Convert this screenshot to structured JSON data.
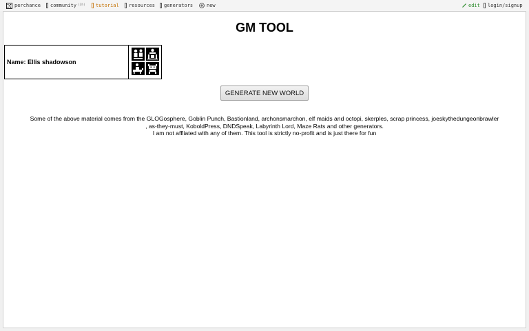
{
  "nav": {
    "items": [
      {
        "label": "perchance",
        "icon": "dice-icon"
      },
      {
        "label": "community",
        "badge": "(3h)",
        "icon": "community-icon"
      },
      {
        "label": "tutorial",
        "icon": "tutorial-icon"
      },
      {
        "label": "resources",
        "icon": "resources-icon"
      },
      {
        "label": "generators",
        "icon": "generators-icon"
      },
      {
        "label": "new",
        "icon": "plus-circle-icon"
      }
    ],
    "edit_label": "edit",
    "login_label": "login/signup"
  },
  "main": {
    "title": "GM TOOL",
    "npc": {
      "name": "Name: Ellis shadowson",
      "portrait_icons": [
        "heroes-icon",
        "camp-icon",
        "rider-icon",
        "monsters-icon"
      ]
    },
    "generate_label": "GENERATE NEW WORLD",
    "credits": {
      "line1": "Some of the above material comes from the GLOGosphere, Goblin Punch, Bastionland, archonsmarchon, elf maids and octopi, skerples, scrap princess, joeskythedungeonbrawler",
      "line2": ", as-they-must, KoboldPress, DNDSpeak, Labyrinth Lord, Maze Rats and other generators.",
      "line3": "I am not affliated with any of them. This tool is strictly no-profit and is just there for fun"
    }
  },
  "colors": {
    "tutorial": "#c36f00",
    "edit": "#2a8a2a",
    "panel_bg": "#ffffff",
    "page_bg": "#f0f0f0"
  }
}
